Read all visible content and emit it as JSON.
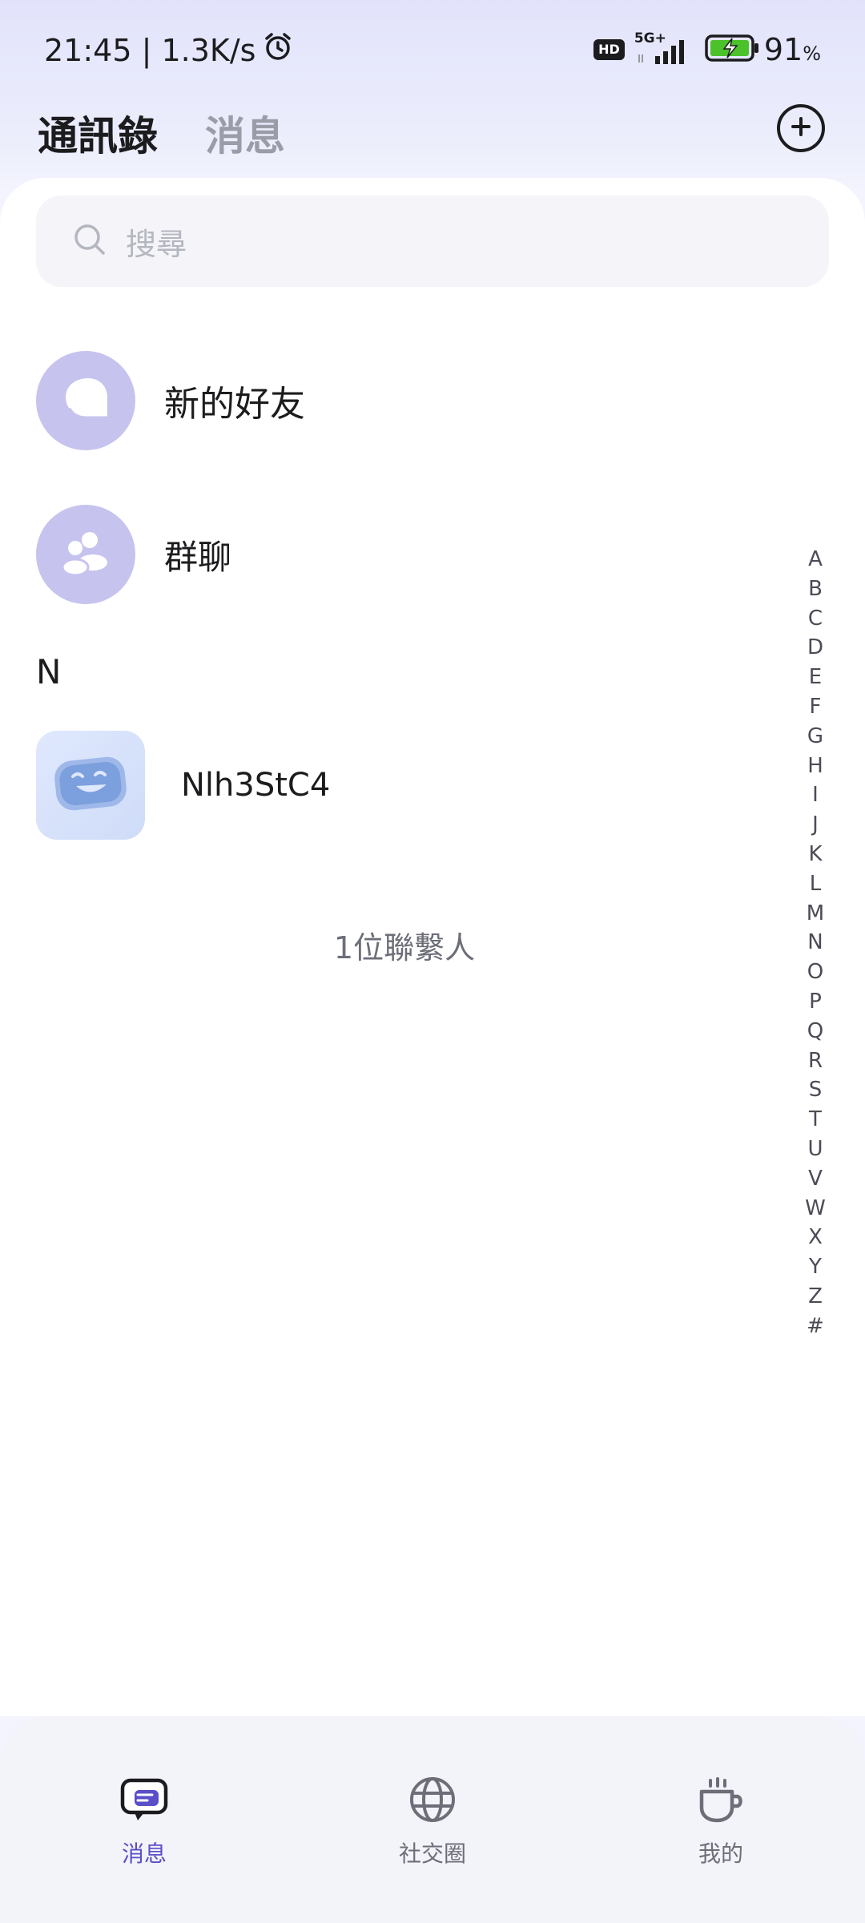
{
  "status_bar": {
    "time_speed": "21:45 | 1.3K/s",
    "hd": "HD",
    "network": "5G+",
    "battery": "91",
    "battery_unit": "%"
  },
  "header": {
    "tab_contacts": "通訊錄",
    "tab_messages": "消息"
  },
  "search": {
    "placeholder": "搜尋"
  },
  "entries": {
    "new_friends": "新的好友",
    "group_chat": "群聊"
  },
  "section": {
    "letter": "N"
  },
  "contact": {
    "name": "Nlh3StC4"
  },
  "contact_count": "1位聯繫人",
  "alpha_index": [
    "A",
    "B",
    "C",
    "D",
    "E",
    "F",
    "G",
    "H",
    "I",
    "J",
    "K",
    "L",
    "M",
    "N",
    "O",
    "P",
    "Q",
    "R",
    "S",
    "T",
    "U",
    "V",
    "W",
    "X",
    "Y",
    "Z",
    "#"
  ],
  "bottom_nav": {
    "messages": "消息",
    "social": "社交圈",
    "me": "我的"
  },
  "colors": {
    "accent": "#5a4fc8",
    "avatar_purple": "#c6c3ee"
  }
}
